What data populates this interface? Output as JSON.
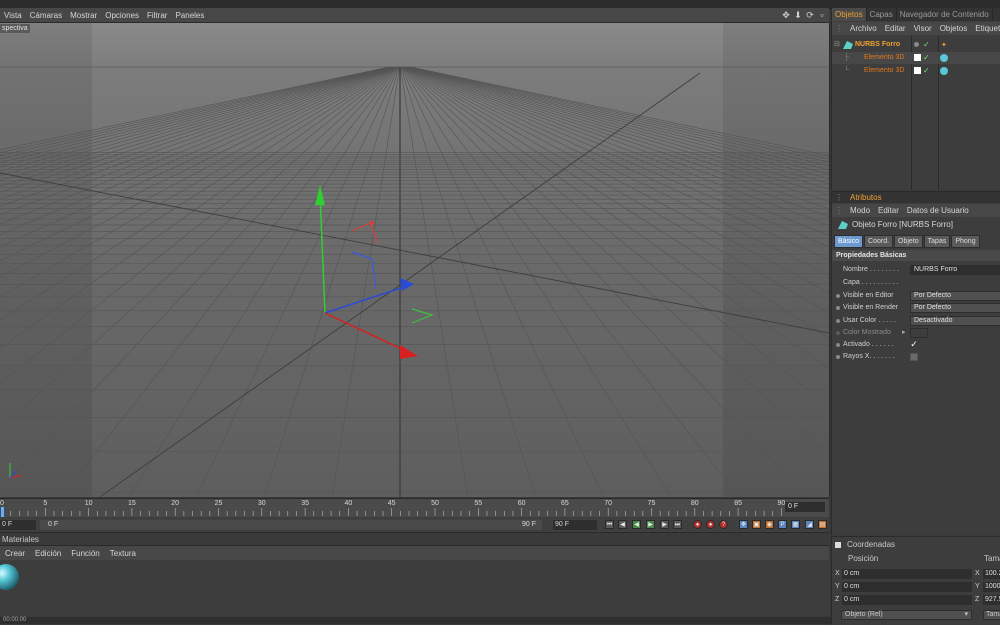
{
  "viewport": {
    "menu": [
      "Vista",
      "Cámaras",
      "Mostrar",
      "Opciones",
      "Filtrar",
      "Paneles"
    ],
    "label": "spectiva"
  },
  "timeline": {
    "ticks": [
      "0",
      "5",
      "10",
      "15",
      "20",
      "25",
      "30",
      "35",
      "40",
      "45",
      "50",
      "55",
      "60",
      "65",
      "70",
      "75",
      "80",
      "85",
      "90"
    ],
    "current_frame": "0 F"
  },
  "transport": {
    "start": "0 F",
    "range_start": "0 F",
    "range_end": "90 F",
    "end": "90 F"
  },
  "materials": {
    "title": "Materiales",
    "menu": [
      "Crear",
      "Edición",
      "Función",
      "Textura"
    ]
  },
  "objects_panel": {
    "tabs": [
      "Objetos",
      "Capas",
      "Navegador de Contenido"
    ],
    "menu": [
      "Archivo",
      "Editar",
      "Visor",
      "Objetos",
      "Etiquetas"
    ],
    "items": [
      {
        "name": "NURBS Forro",
        "color": "#f0a030"
      },
      {
        "name": "Elemento 3D",
        "color": "#e07a1a"
      },
      {
        "name": "Elemento 3D",
        "color": "#e07a1a"
      }
    ]
  },
  "attributes_panel": {
    "title": "Atributos",
    "menu": [
      "Modo",
      "Editar",
      "Datos de Usuario"
    ],
    "object_label": "Objeto Forro [NURBS Forro]",
    "tabs": [
      "Básico",
      "Coord.",
      "Objeto",
      "Tapas",
      "Phong"
    ],
    "section": "Propiedades Básicas",
    "props": {
      "nombre": {
        "label": "Nombre . . . . . . . .",
        "value": "NURBS Forro"
      },
      "capa": {
        "label": "Capa . . . . . . . . . ."
      },
      "vis_editor": {
        "label": "Visible en Editor",
        "value": "Por Defecto"
      },
      "vis_render": {
        "label": "Visible en Render",
        "value": "Por Defecto"
      },
      "usar_color": {
        "label": "Usar Color . . . . .",
        "value": "Desactivado"
      },
      "color_mostrado": {
        "label": "Color Mostrado"
      },
      "activado": {
        "label": "Activado . . . . . .",
        "checked": "✓"
      },
      "rayos_x": {
        "label": "Rayos X. . . . . . ."
      }
    }
  },
  "coords_panel": {
    "title": "Coordenadas",
    "position_label": "Posición",
    "size_label": "Tama",
    "rows": [
      {
        "axis": "X",
        "value": "0 cm",
        "axis2": "X",
        "value2": "100.2"
      },
      {
        "axis": "Y",
        "value": "0 cm",
        "axis2": "Y",
        "value2": "1000"
      },
      {
        "axis": "Z",
        "value": "0 cm",
        "axis2": "Z",
        "value2": "927.5"
      }
    ],
    "mode": "Objeto (Rel)",
    "mode2": "Tama"
  },
  "status": {
    "text": "00:00:00"
  }
}
